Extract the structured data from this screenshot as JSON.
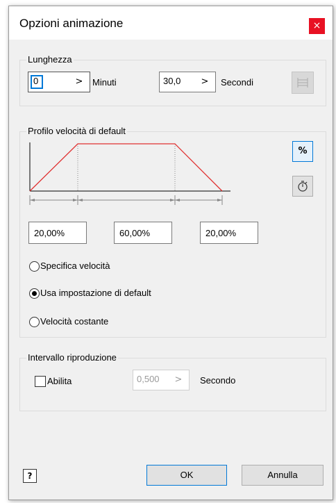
{
  "dialog": {
    "title": "Opzioni animazione",
    "close_glyph": "×"
  },
  "length": {
    "group_title": "Lunghezza",
    "minutes_value": "0",
    "minutes_label": "Minuti",
    "seconds_value": "30,0",
    "seconds_label": "Secondi",
    "spin_arrow": ">",
    "fit_icon": "range-fit-icon"
  },
  "velocity": {
    "group_title": "Profilo velocità di default",
    "accel_pct": "20,00%",
    "const_pct": "60,00%",
    "decel_pct": "20,00%",
    "percent_button_label": "%",
    "time_button_icon": "stopwatch-icon",
    "profile_segments": [
      0.2,
      0.6,
      0.2
    ],
    "radio_options": [
      {
        "label": "Specifica velocità",
        "checked": false
      },
      {
        "label": "Usa impostazione di default",
        "checked": true
      },
      {
        "label": "Velocità costante",
        "checked": false
      }
    ],
    "colors": {
      "profile_line": "#e03030",
      "highlight_border": "#0078d7"
    }
  },
  "playback": {
    "group_title": "Intervallo riproduzione",
    "enable_label": "Abilita",
    "enable_checked": false,
    "interval_value": "0,500",
    "interval_unit": "Secondo"
  },
  "footer": {
    "help_icon": "help-icon",
    "help_glyph": "?",
    "ok_label": "OK",
    "cancel_label": "Annulla"
  }
}
